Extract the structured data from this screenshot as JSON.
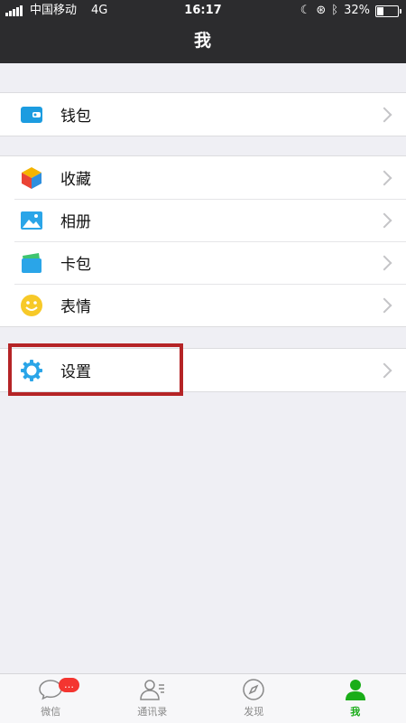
{
  "status_bar": {
    "carrier": "中国移动",
    "network": "4G",
    "time": "16:17",
    "battery": "32%",
    "battery_level": 0.32
  },
  "nav": {
    "title": "我"
  },
  "groups": [
    {
      "items": [
        {
          "label": "钱包",
          "icon": "wallet-icon"
        }
      ]
    },
    {
      "items": [
        {
          "label": "收藏",
          "icon": "favorites-cube-icon"
        },
        {
          "label": "相册",
          "icon": "album-picture-icon"
        },
        {
          "label": "卡包",
          "icon": "card-pack-icon"
        },
        {
          "label": "表情",
          "icon": "sticker-smiley-icon"
        }
      ]
    },
    {
      "items": [
        {
          "label": "设置",
          "icon": "settings-gear-icon"
        }
      ]
    }
  ],
  "tabbar": {
    "tabs": [
      {
        "label": "微信",
        "icon": "chat-bubble-icon",
        "badge": "…"
      },
      {
        "label": "通讯录",
        "icon": "contacts-icon"
      },
      {
        "label": "发现",
        "icon": "compass-icon"
      },
      {
        "label": "我",
        "icon": "me-person-icon",
        "active": true
      }
    ]
  },
  "colors": {
    "accent_green": "#1aad19",
    "badge_red": "#f43530",
    "highlight_red": "#b52426",
    "nav_background": "#2c2c2e"
  }
}
